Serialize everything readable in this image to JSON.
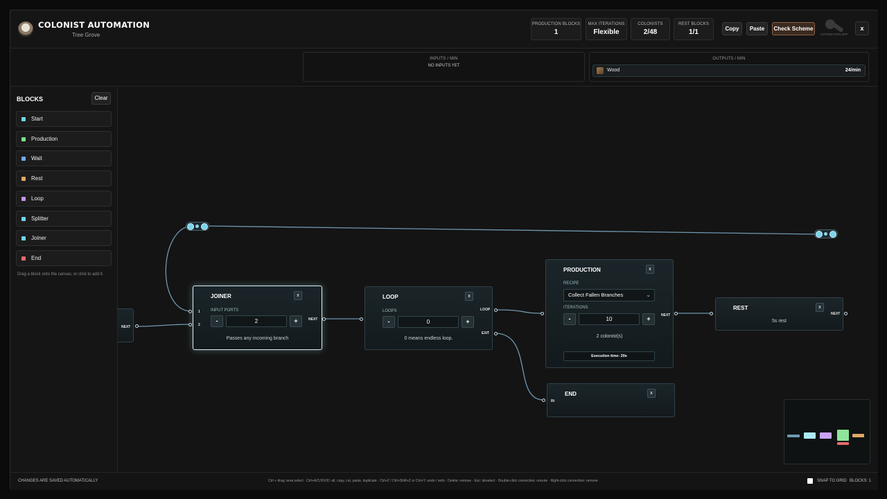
{
  "header": {
    "title": "COLONIST AUTOMATION",
    "subtitle": "Tree Grove",
    "stats": [
      {
        "label": "PRODUCTION BLOCKS",
        "value": "1"
      },
      {
        "label": "MAX ITERATIONS",
        "value": "Flexible"
      },
      {
        "label": "COLONISTS",
        "value": "2/48"
      },
      {
        "label": "REST BLOCKS",
        "value": "1/1"
      }
    ],
    "copy_label": "Copy",
    "paste_label": "Paste",
    "check_label": "Check Scheme",
    "automation_label": "AUTOMATION OFF",
    "close_label": "x"
  },
  "inputs": {
    "caption": "INPUTS / MIN",
    "empty": "NO INPUTS YET"
  },
  "outputs": {
    "caption": "OUTPUTS / MIN",
    "items": [
      {
        "name": "Wood",
        "rate": "24/min"
      }
    ]
  },
  "sidebar": {
    "title": "BLOCKS",
    "clear_label": "Clear",
    "items": [
      {
        "label": "Start",
        "color": "#6fd6ee"
      },
      {
        "label": "Production",
        "color": "#7be08a"
      },
      {
        "label": "Wait",
        "color": "#7aa6e8"
      },
      {
        "label": "Rest",
        "color": "#e0a866"
      },
      {
        "label": "Loop",
        "color": "#c394e8"
      },
      {
        "label": "Splitter",
        "color": "#6fd6ee"
      },
      {
        "label": "Joiner",
        "color": "#6fd6ee"
      },
      {
        "label": "End",
        "color": "#e66a6a"
      }
    ],
    "hint": "Drag a block onto the canvas, or click to add it."
  },
  "canvas": {
    "offscreen_port": "NEXT",
    "joiner": {
      "title": "JOINER",
      "close": "x",
      "field": "INPUT PORTS",
      "value": "2",
      "note": "Passes any incoming branch",
      "in1": "1",
      "in2": "2",
      "out": "NEXT"
    },
    "loop": {
      "title": "LOOP",
      "close": "x",
      "field": "LOOPS",
      "value": "0",
      "note": "0 means endless loop.",
      "out_loop": "LOOP",
      "out_exit": "EXIT"
    },
    "production": {
      "title": "PRODUCTION",
      "close": "x",
      "recipe_label": "RECIPE",
      "recipe": "Collect Fallen Branches",
      "iter_label": "ITERATIONS",
      "iterations": "10",
      "colonists": "2 colonist(s)",
      "exec": "Execution time: 20s",
      "out": "NEXT"
    },
    "rest": {
      "title": "REST",
      "close": "x",
      "note": "5s rest",
      "out": "NEXT"
    },
    "end": {
      "title": "END",
      "close": "x",
      "in": "IN"
    },
    "stepper": {
      "minus": "-",
      "plus": "+"
    }
  },
  "footer": {
    "left": "CHANGES ARE SAVED AUTOMATICALLY",
    "shortcuts": "Ctrl + drag: area select · Ctrl+A/C/X/V/D: all, copy, cut, paste, duplicate · Ctrl+Z / Ctrl+Shift+Z or Ctrl+Y: undo / redo · Delete: remove · Esc: deselect · Double-click connection: reroute · Right-click connection: remove",
    "snap": "SNAP TO GRID",
    "blocks": "BLOCKS: 1"
  }
}
